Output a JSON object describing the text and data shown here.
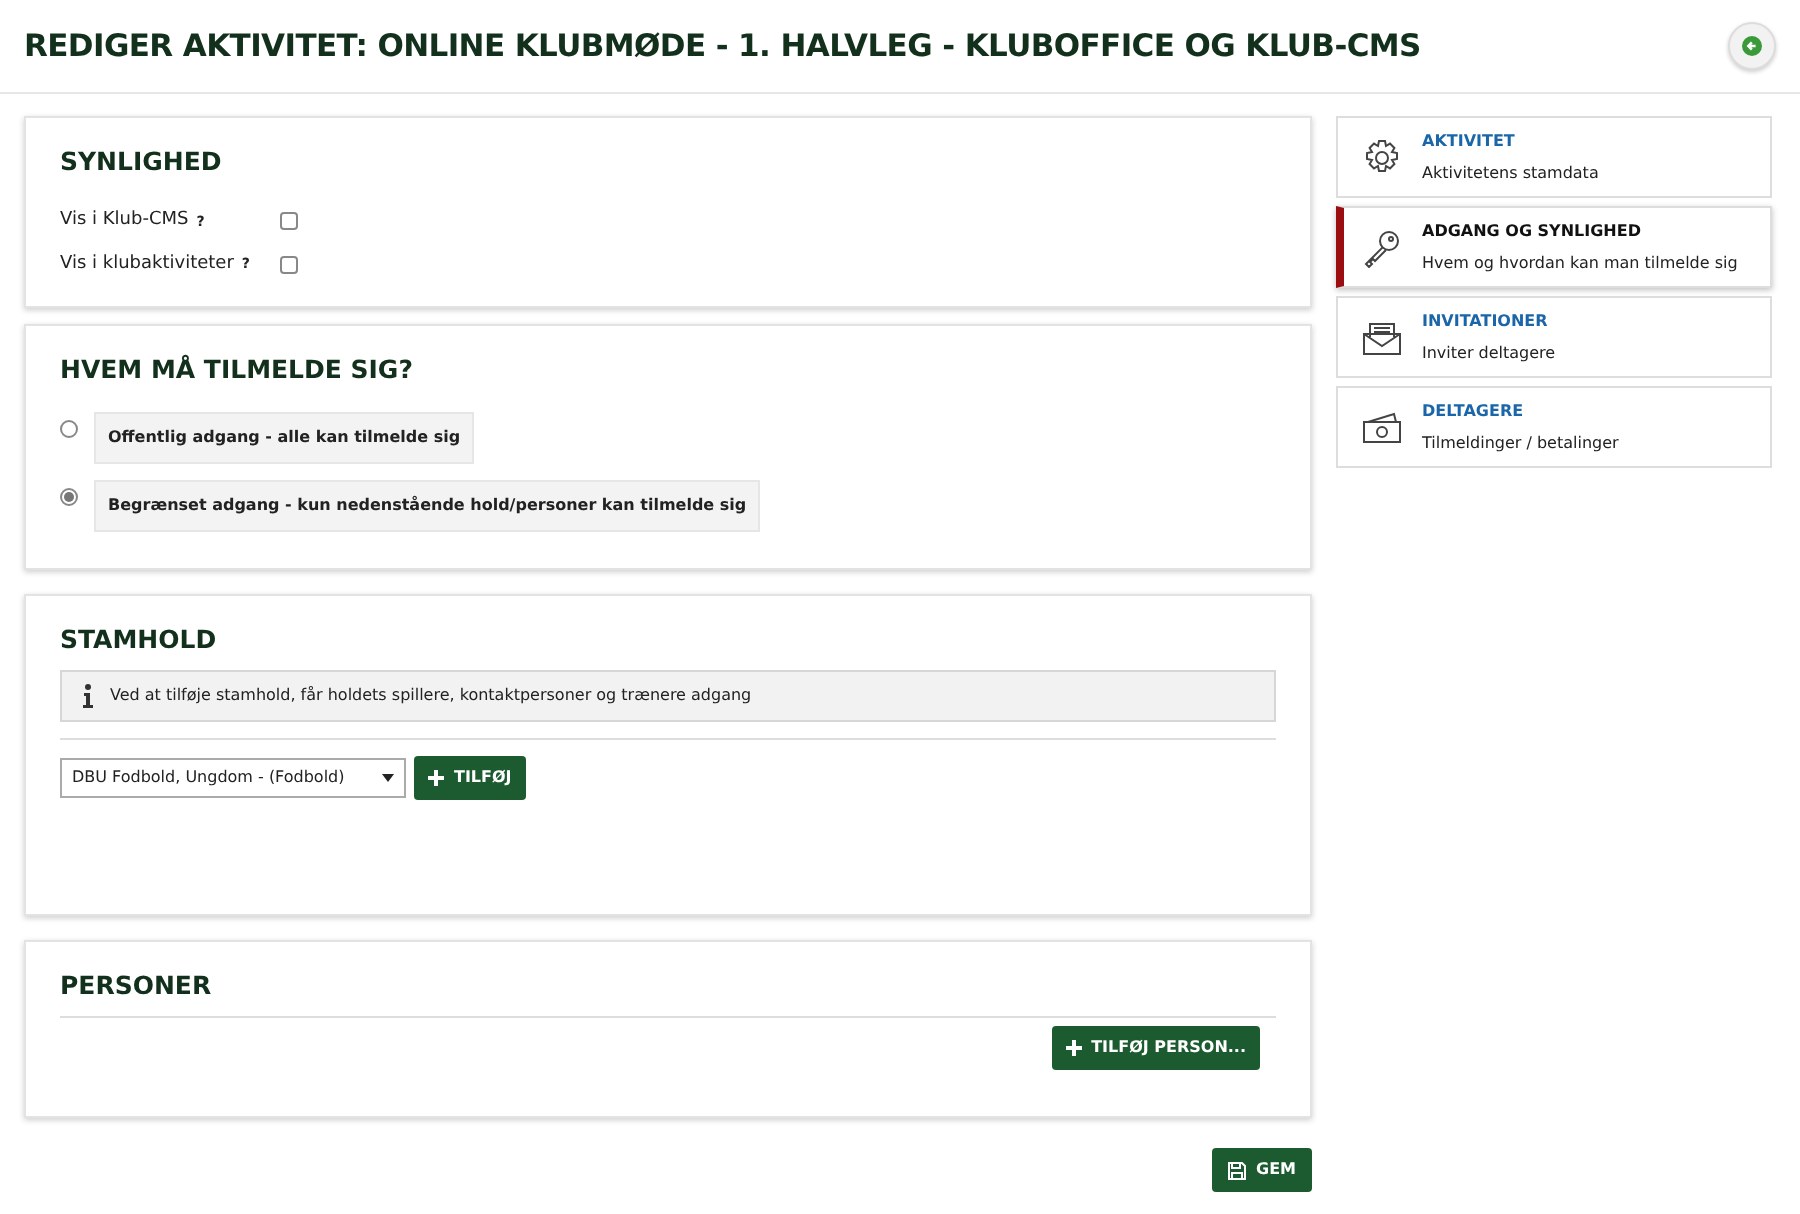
{
  "page_title": "REDIGER AKTIVITET: ONLINE KLUBMØDE - 1. HALVLEG - KLUBOFFICE OG KLUB-CMS",
  "synlighed": {
    "title": "SYNLIGHED",
    "options": [
      {
        "label": "Vis i Klub-CMS",
        "help": "?",
        "checked": false
      },
      {
        "label": "Vis i klubaktiviteter",
        "help": "?",
        "checked": false
      }
    ]
  },
  "access": {
    "title": "HVEM MÅ TILMELDE SIG?",
    "options": [
      {
        "label": "Offentlig adgang - alle kan tilmelde sig",
        "selected": false
      },
      {
        "label": "Begrænset adgang - kun nedenstående hold/personer kan tilmelde sig",
        "selected": true
      }
    ]
  },
  "stamhold": {
    "title": "STAMHOLD",
    "info": "Ved at tilføje stamhold, får holdets spillere, kontaktpersoner og trænere adgang",
    "select_value": "DBU Fodbold, Ungdom - (Fodbold)",
    "add_button": "TILFØJ"
  },
  "personer": {
    "title": "PERSONER",
    "add_button": "TILFØJ PERSON..."
  },
  "save_button": "GEM",
  "sidebar": {
    "items": [
      {
        "title": "AKTIVITET",
        "subtitle": "Aktivitetens stamdata",
        "selected": false
      },
      {
        "title": "ADGANG OG SYNLIGHED",
        "subtitle": "Hvem og hvordan kan man tilmelde sig",
        "selected": true
      },
      {
        "title": "INVITATIONER",
        "subtitle": "Inviter deltagere",
        "selected": false
      },
      {
        "title": "DELTAGERE",
        "subtitle": "Tilmeldinger / betalinger",
        "selected": false
      }
    ]
  }
}
